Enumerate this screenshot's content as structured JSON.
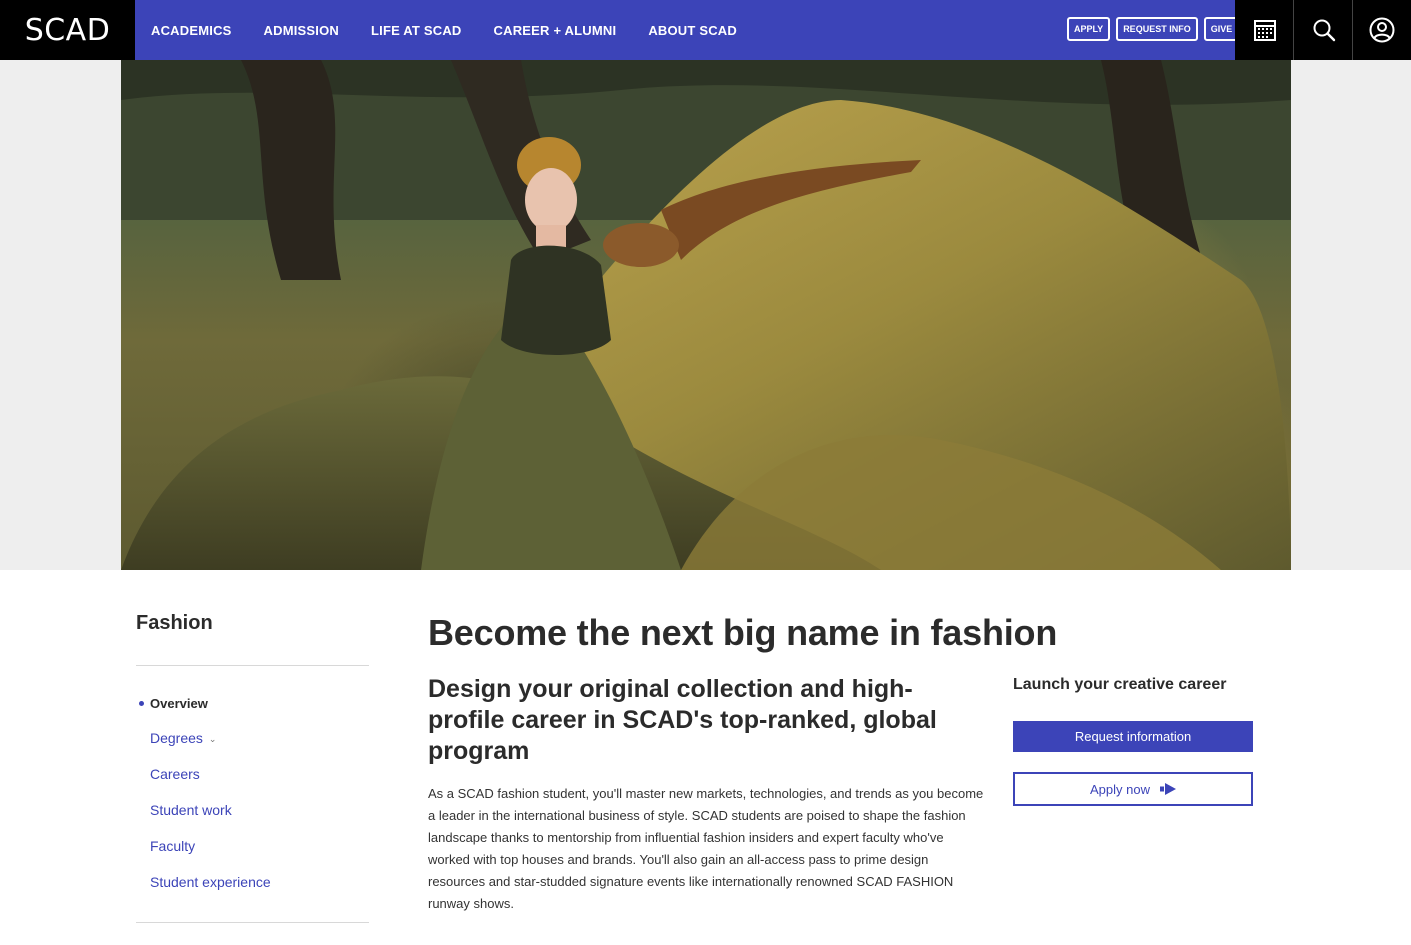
{
  "header": {
    "logo": "SCAD",
    "nav": [
      "ACADEMICS",
      "ADMISSION",
      "LIFE AT SCAD",
      "CAREER + ALUMNI",
      "ABOUT SCAD"
    ],
    "ctas": {
      "apply": "APPLY",
      "request_info": "REQUEST INFO",
      "give": "GIVE"
    },
    "icons": [
      "calendar-icon",
      "search-icon",
      "account-icon"
    ],
    "colors": {
      "nav_bg": "#3c44b8",
      "utility_bg": "#000000"
    }
  },
  "sidebar": {
    "title": "Fashion",
    "items": [
      "Overview",
      "Degrees",
      "Careers",
      "Student work",
      "Faculty",
      "Student experience"
    ],
    "active": "Overview"
  },
  "main": {
    "heading": "Become the next big name in fashion",
    "subheading": "Design your original collection and high-profile career in SCAD's top-ranked, global program",
    "body": "As a SCAD fashion student, you'll master new markets, technologies, and trends as you become a leader in the international business of style. SCAD students are poised to shape the fashion landscape thanks to mentorship from influential fashion insiders and expert faculty who've worked with top houses and brands. You'll also gain an all-access pass to prime design resources and star-studded signature events like internationally renowned SCAD FASHION runway shows."
  },
  "aside": {
    "title": "Launch your creative career",
    "request_button": "Request information",
    "apply_button": "Apply now"
  }
}
